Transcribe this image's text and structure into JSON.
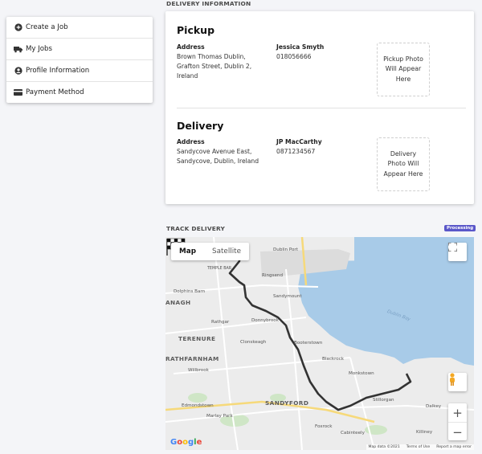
{
  "sidebar": {
    "items": [
      {
        "label": "Create a Job",
        "icon": "plus-circle-icon"
      },
      {
        "label": "My Jobs",
        "icon": "truck-icon"
      },
      {
        "label": "Profile Information",
        "icon": "user-circle-icon"
      },
      {
        "label": "Payment Method",
        "icon": "credit-card-icon"
      }
    ]
  },
  "delivery_information": {
    "section_title": "DELIVERY INFORMATION",
    "pickup": {
      "heading": "Pickup",
      "address_label": "Address",
      "address": "Brown Thomas Dublin, Grafton Street, Dublin 2, Ireland",
      "contact_name": "Jessica Smyth",
      "contact_phone": "018056666",
      "photo_placeholder": "Pickup Photo Will Appear Here"
    },
    "delivery": {
      "heading": "Delivery",
      "address_label": "Address",
      "address": "Sandycove Avenue East, Sandycove, Dublin, Ireland",
      "contact_name": "JP MacCarthy",
      "contact_phone": "0871234567",
      "photo_placeholder": "Delivery Photo Will Appear Here"
    }
  },
  "track_delivery": {
    "section_title": "TRACK DELIVERY",
    "status_badge": "Processing",
    "status_color": "#5a57c9",
    "map": {
      "type_options": [
        "Map",
        "Satellite"
      ],
      "selected_type": "Map",
      "zoom_in": "+",
      "zoom_out": "−",
      "google_logo": "Google",
      "attribution": [
        "Map data ©2021",
        "Terms of Use",
        "Report a map error"
      ],
      "place_labels": {
        "dublin_port": "Dublin Port",
        "ringsend": "Ringsend",
        "sandymount": "Sandymount",
        "dolphins_barn": "Dolphins Barn",
        "ranelagh": "ANAGH",
        "rathgar": "Rathgar",
        "donnybrook": "Donnybrook",
        "clonskeagh": "Clonskeagh",
        "terenure": "TERENURE",
        "booterstown": "Booterstown",
        "rathfarnham": "RATHFARNHAM",
        "willbrook": "Willbrook",
        "blackrock": "Blackrock",
        "monkstown": "Monkstown",
        "sandyford": "SANDYFORD",
        "edmondstown": "Edmondstown",
        "marlay_park": "Marlay Park",
        "foxrock": "Foxrock",
        "cabinteely": "Cabinteely",
        "killiney": "Killiney",
        "dalkey": "Dalkey",
        "dublin_bay": "Dublin Bay",
        "temple_bar": "TEMPLE BAR",
        "stillorgan": "Stillorgan"
      }
    }
  }
}
